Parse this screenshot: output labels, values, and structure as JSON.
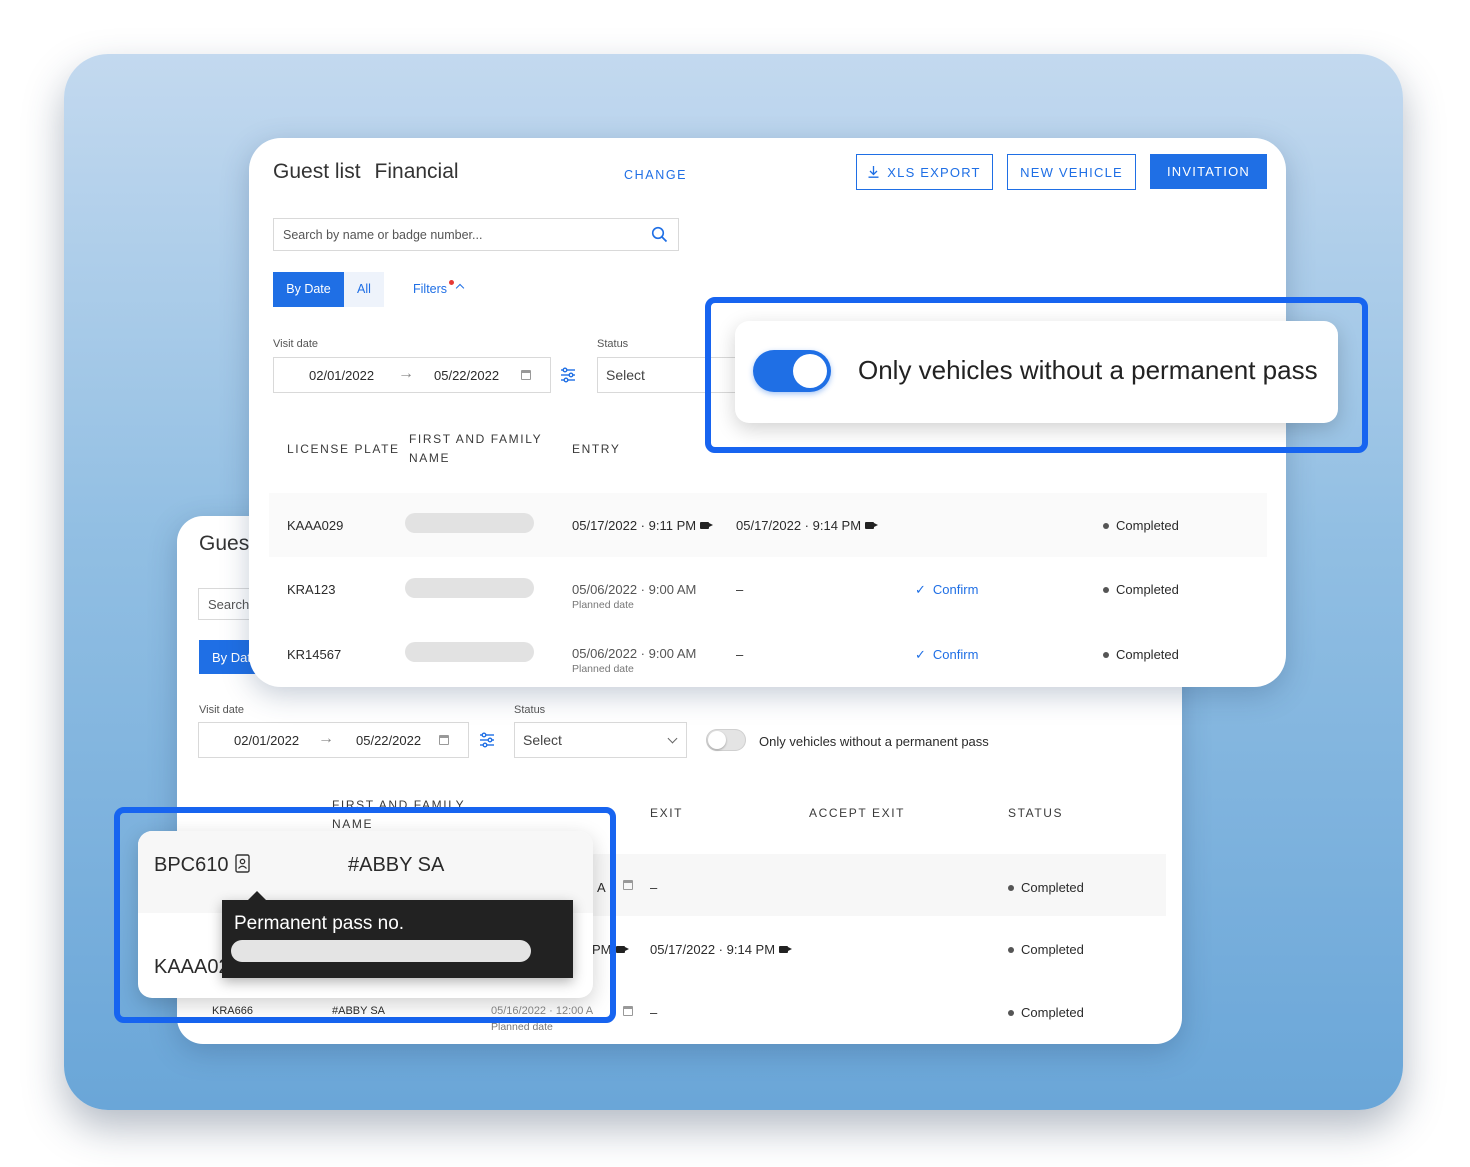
{
  "front": {
    "title": "Guest list",
    "title_sub": "Financial",
    "change_link": "CHANGE",
    "xls_export": "XLS EXPORT",
    "new_vehicle": "NEW VEHICLE",
    "invitation": "INVITATION",
    "search_placeholder": "Search by name or badge number...",
    "tab_by_date": "By Date",
    "tab_all": "All",
    "filters": "Filters",
    "visit_date_label": "Visit date",
    "date_from": "02/01/2022",
    "date_to": "05/22/2022",
    "status_label": "Status",
    "status_value": "Select",
    "headers": {
      "license_plate": "LICENSE PLATE",
      "name_line1": "FIRST AND FAMILY",
      "name_line2": "NAME",
      "entry": "ENTRY"
    },
    "rows": [
      {
        "plate": "KAAA029",
        "entry": "05/17/2022 · 9:11 PM",
        "entry_sub": "",
        "exit": "05/17/2022 · 9:14 PM",
        "accept": "",
        "status": "Completed"
      },
      {
        "plate": "KRA123",
        "entry": "05/06/2022 · 9:00 AM",
        "entry_sub": "Planned date",
        "exit": "–",
        "accept": "Confirm",
        "status": "Completed"
      },
      {
        "plate": "KR14567",
        "entry": "05/06/2022 · 9:00 AM",
        "entry_sub": "Planned date",
        "exit": "–",
        "accept": "Confirm",
        "status": "Completed"
      }
    ]
  },
  "toggle_callout": {
    "label": "Only vehicles without a permanent pass",
    "on": true
  },
  "back": {
    "title_partial": "Gues",
    "search_partial": "Search",
    "tab_partial": "By Dat",
    "visit_date_label": "Visit date",
    "date_from": "02/01/2022",
    "date_to": "05/22/2022",
    "status_label": "Status",
    "status_value": "Select",
    "toggle_label": "Only vehicles without a permanent pass",
    "toggle_on": false,
    "headers": {
      "name_line1": "FIRST AND FAMILY",
      "name_line2": "NAME",
      "exit": "EXIT",
      "accept_exit": "ACCEPT EXIT",
      "status": "STATUS"
    },
    "rows": [
      {
        "entry_partial": "A",
        "exit": "–",
        "status": "Completed"
      },
      {
        "entry_partial": "PM",
        "exit": "05/17/2022 · 9:14 PM",
        "status": "Completed"
      },
      {
        "plate": "KRA666",
        "name": "#ABBY SA",
        "entry": "05/16/2022 · 12:00 A",
        "entry_sub": "Planned date",
        "exit": "–",
        "status": "Completed"
      }
    ]
  },
  "pass_callout": {
    "plate1": "BPC610",
    "name1": "#ABBY SA",
    "plate2_partial": "KAAA02",
    "tooltip_title": "Permanent pass no."
  },
  "colors": {
    "accent": "#1f6fe5",
    "highlight": "#1764f0",
    "tooltip_bg": "#222222"
  }
}
